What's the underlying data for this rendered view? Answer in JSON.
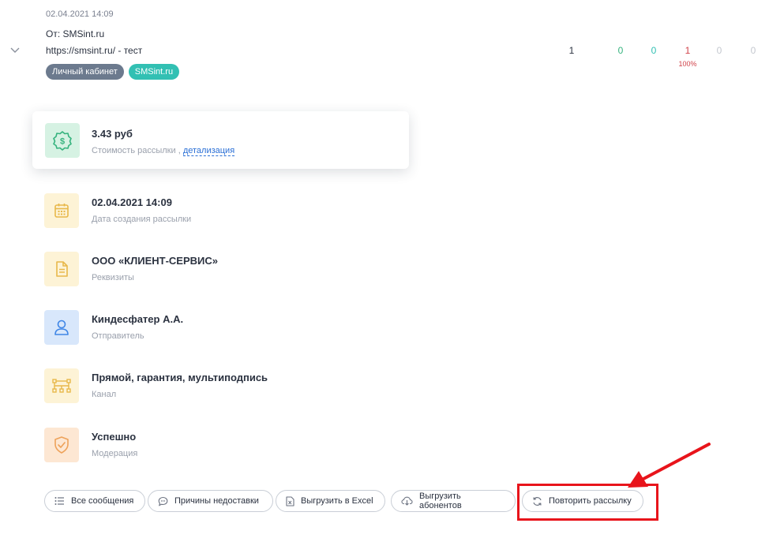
{
  "message": {
    "date": "02.04.2021 14:09",
    "from": "От: SMSint.ru",
    "link_text": "https://smsint.ru/ - тест",
    "tags": [
      "Личный кабинет",
      "SMSint.ru"
    ]
  },
  "stats": {
    "total": "1",
    "green": "0",
    "teal": "0",
    "red": "1",
    "red_percent": "100%",
    "gray1": "0",
    "gray2": "0"
  },
  "cost": {
    "amount": "3.43 руб",
    "label": "Стоимость рассылки ,",
    "detail_link": "детализация"
  },
  "details": [
    {
      "title": "02.04.2021 14:09",
      "subtitle": "Дата создания рассылки",
      "icon": "calendar-icon"
    },
    {
      "title": "ООО «КЛИЕНТ-СЕРВИС»",
      "subtitle": "Реквизиты",
      "icon": "document-icon"
    },
    {
      "title": "Киндесфатер А.А.",
      "subtitle": "Отправитель",
      "icon": "user-icon"
    },
    {
      "title": "Прямой, гарантия, мультиподпись",
      "subtitle": "Канал",
      "icon": "channel-icon"
    },
    {
      "title": "Успешно",
      "subtitle": "Модерация",
      "icon": "shield-check-icon"
    }
  ],
  "actions": {
    "all_messages": "Все сообщения",
    "reasons": "Причины недоставки",
    "export_excel": "Выгрузить в Excel",
    "export_subscribers": "Выгрузить абонентов",
    "repeat": "Повторить рассылку"
  },
  "colors": {
    "accent_blue": "#2a6fd6",
    "success_green": "#36b37e",
    "teal": "#32c0b3",
    "error_red": "#d0434a",
    "highlight_red": "#e8141b"
  }
}
